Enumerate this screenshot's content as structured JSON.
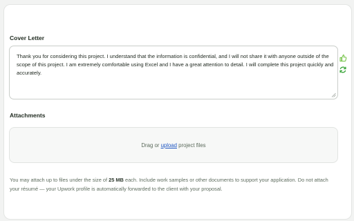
{
  "cover_letter": {
    "label": "Cover Letter",
    "text": "Thank you for considering this project. I understand that the information is confidential, and I will not share it with anyone outside of the scope of this project. I am extremely comfortable using Excel and I have a great attention to detail. I will complete this project quickly and accurately."
  },
  "side_tools": {
    "thumbs_up_icon": "thumbs-up-icon",
    "refresh_icon": "refresh-icon",
    "accent": "#6bbf3b"
  },
  "attachments": {
    "label": "Attachments",
    "drop_prefix": "Drag or ",
    "upload_link": "upload",
    "drop_suffix": " project files"
  },
  "help": {
    "part1": "You may attach up to files under the size of ",
    "size": "25 MB",
    "part2": " each. Include work samples or other documents to support your application. Do not attach your résumé — your Upwork profile is automatically forwarded to the client with your proposal."
  },
  "colors": {
    "link": "#1f57c3",
    "border": "#c9cdc9"
  }
}
